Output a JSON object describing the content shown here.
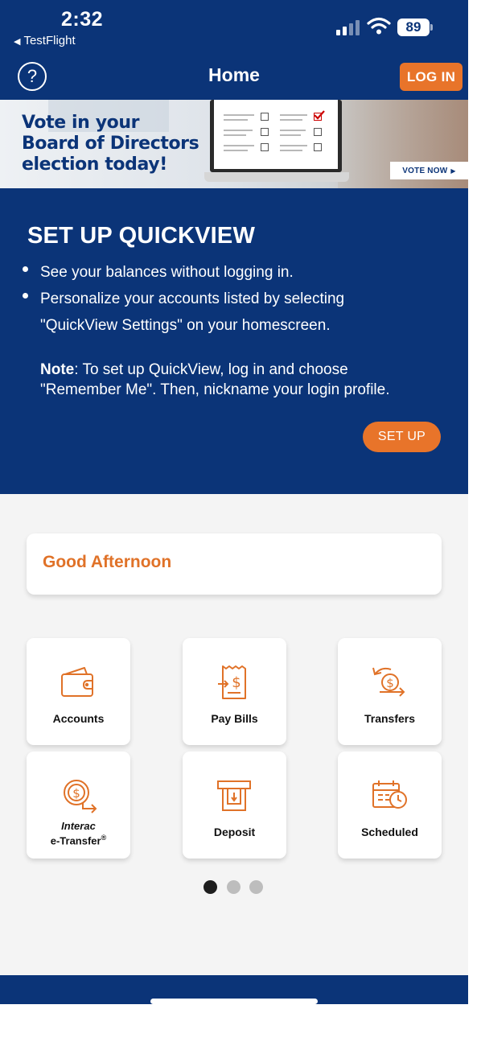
{
  "status_bar": {
    "time": "2:32",
    "back_label": "TestFlight",
    "battery": "89"
  },
  "nav": {
    "help_label": "?",
    "title": "Home",
    "login_label": "LOG IN"
  },
  "banner": {
    "line1": "Vote in your",
    "line2": "Board of Directors",
    "line3": "election today!",
    "cta": "VOTE NOW"
  },
  "quickview": {
    "title": "SET UP QUICKVIEW",
    "bullet1": "See your balances without logging in.",
    "bullet2_line1": "Personalize your accounts listed by selecting",
    "bullet2_line2": "\"QuickView Settings\" on your homescreen.",
    "note_label": "Note",
    "note_line1": ": To set up QuickView, log in and choose",
    "note_line2": "\"Remember Me\". Then, nickname your login profile.",
    "setup_label": "SET UP"
  },
  "greeting": "Good Afternoon",
  "tiles": {
    "accounts": "Accounts",
    "pay_bills": "Pay Bills",
    "transfers": "Transfers",
    "interac_brand": "Interac",
    "interac_label": "e-Transfer",
    "interac_mark": "®",
    "deposit": "Deposit",
    "scheduled": "Scheduled"
  },
  "pager": {
    "pages": 3,
    "active": 1
  },
  "colors": {
    "navy": "#0b3478",
    "orange": "#e8742a",
    "greeting": "#e07228",
    "background": "#f4f4f4"
  },
  "icons": {
    "back": "back-arrow-icon",
    "signal": "signal-icon",
    "wifi": "wifi-icon",
    "battery": "battery-icon",
    "help": "question-mark-icon",
    "accounts": "wallet-icon",
    "pay_bills": "receipt-dollar-icon",
    "transfers": "dollar-exchange-icon",
    "interac": "dollar-send-icon",
    "deposit": "atm-deposit-icon",
    "scheduled": "calendar-clock-icon"
  }
}
